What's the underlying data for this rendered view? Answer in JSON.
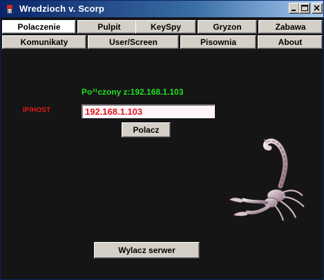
{
  "window": {
    "title": "Wredzioch v. Scorp",
    "controls": {
      "minimize": "minimize-icon",
      "maximize": "maximize-icon",
      "close": "close-icon"
    }
  },
  "tabs": {
    "row1": [
      "Polaczenie",
      "Pulpit",
      "KeySpy",
      "Gryzon",
      "Zabawa"
    ],
    "row2": [
      "Komunikaty",
      "User/Screen",
      "Pisownia",
      "About"
    ],
    "active": "Polaczenie"
  },
  "connection": {
    "status": "Po³¹czony z:192.168.1.103",
    "ip_label": "IP/HOST",
    "ip_value": "192.168.1.103",
    "connect_label": "Polacz",
    "disconnect_label": "Wylacz serwer"
  },
  "colors": {
    "background": "#151515",
    "status_text": "#22dd22",
    "label_text": "#dd1a1a",
    "input_background": "#fff4fa",
    "button_face": "#d4d0c8",
    "titlebar_start": "#0a246a",
    "titlebar_end": "#a6caf0"
  },
  "icons": {
    "app": "scorpion-app-icon",
    "illustration": "scorpion-illustration"
  }
}
